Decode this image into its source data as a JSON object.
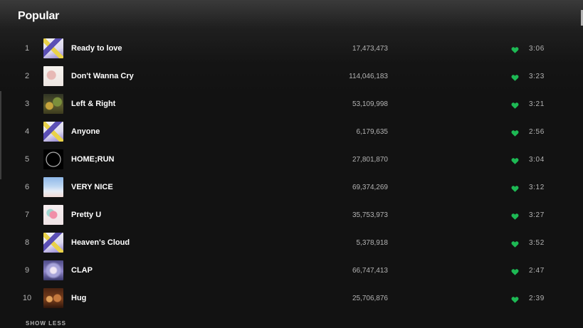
{
  "section": {
    "title": "Popular",
    "show_less_label": "SHOW LESS"
  },
  "colors": {
    "background": "#121212",
    "accent_green": "#1db954",
    "secondary_text": "#b3b3b3"
  },
  "tracks": [
    {
      "number": "1",
      "title": "Ready to love",
      "plays": "17,473,473",
      "liked": true,
      "duration": "3:06",
      "art": "art-a"
    },
    {
      "number": "2",
      "title": "Don't Wanna Cry",
      "plays": "114,046,183",
      "liked": true,
      "duration": "3:23",
      "art": "art-b"
    },
    {
      "number": "3",
      "title": "Left & Right",
      "plays": "53,109,998",
      "liked": true,
      "duration": "3:21",
      "art": "art-c"
    },
    {
      "number": "4",
      "title": "Anyone",
      "plays": "6,179,635",
      "liked": true,
      "duration": "2:56",
      "art": "art-a"
    },
    {
      "number": "5",
      "title": "HOME;RUN",
      "plays": "27,801,870",
      "liked": true,
      "duration": "3:04",
      "art": "art-d"
    },
    {
      "number": "6",
      "title": "VERY NICE",
      "plays": "69,374,269",
      "liked": true,
      "duration": "3:12",
      "art": "art-e"
    },
    {
      "number": "7",
      "title": "Pretty U",
      "plays": "35,753,973",
      "liked": true,
      "duration": "3:27",
      "art": "art-f"
    },
    {
      "number": "8",
      "title": "Heaven's Cloud",
      "plays": "5,378,918",
      "liked": true,
      "duration": "3:52",
      "art": "art-a"
    },
    {
      "number": "9",
      "title": "CLAP",
      "plays": "66,747,413",
      "liked": true,
      "duration": "2:47",
      "art": "art-g"
    },
    {
      "number": "10",
      "title": "Hug",
      "plays": "25,706,876",
      "liked": true,
      "duration": "2:39",
      "art": "art-h"
    }
  ],
  "icons": {
    "like": "heart-icon"
  }
}
